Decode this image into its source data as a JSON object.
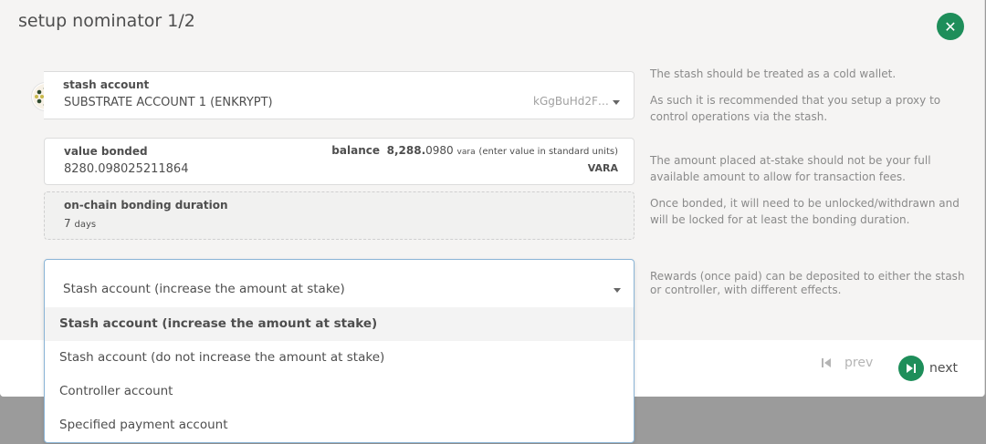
{
  "modal": {
    "title": "setup nominator 1/2",
    "close_icon": "close-icon",
    "accent_color": "#1e8e5a"
  },
  "stash": {
    "label": "stash account",
    "account_name": "SUBSTRATE ACCOUNT 1 (ENKRYPT)",
    "address_short": "kGgBuHd2F…",
    "identicon": "polkadot-identicon"
  },
  "bonded": {
    "label": "value bonded",
    "value": "8280.098025211864",
    "balance_label": "balance",
    "balance_whole": "8,288.",
    "balance_frac": "0980",
    "balance_unit": "vara",
    "units_hint": "(enter value in standard units)",
    "currency": "VARA"
  },
  "duration": {
    "label": "on-chain bonding duration",
    "value": "7",
    "unit": "days"
  },
  "rewards": {
    "selected": "Stash account (increase the amount at stake)",
    "options": [
      "Stash account (increase the amount at stake)",
      "Stash account (do not increase the amount at stake)",
      "Controller account",
      "Specified payment account"
    ]
  },
  "hints": {
    "stash_1": "The stash should be treated as a cold wallet.",
    "stash_2": "As such it is recommended that you setup a proxy to control operations via the stash.",
    "bonded": "The amount placed at-stake should not be your full available amount to allow for transaction fees.",
    "duration": "Once bonded, it will need to be unlocked/withdrawn and will be locked for at least the bonding duration.",
    "rewards": "Rewards (once paid) can be deposited to either the stash or controller, with different effects."
  },
  "footer": {
    "prev_label": "prev",
    "next_label": "next",
    "prev_icon": "skip-back-icon",
    "next_icon": "skip-forward-icon"
  }
}
